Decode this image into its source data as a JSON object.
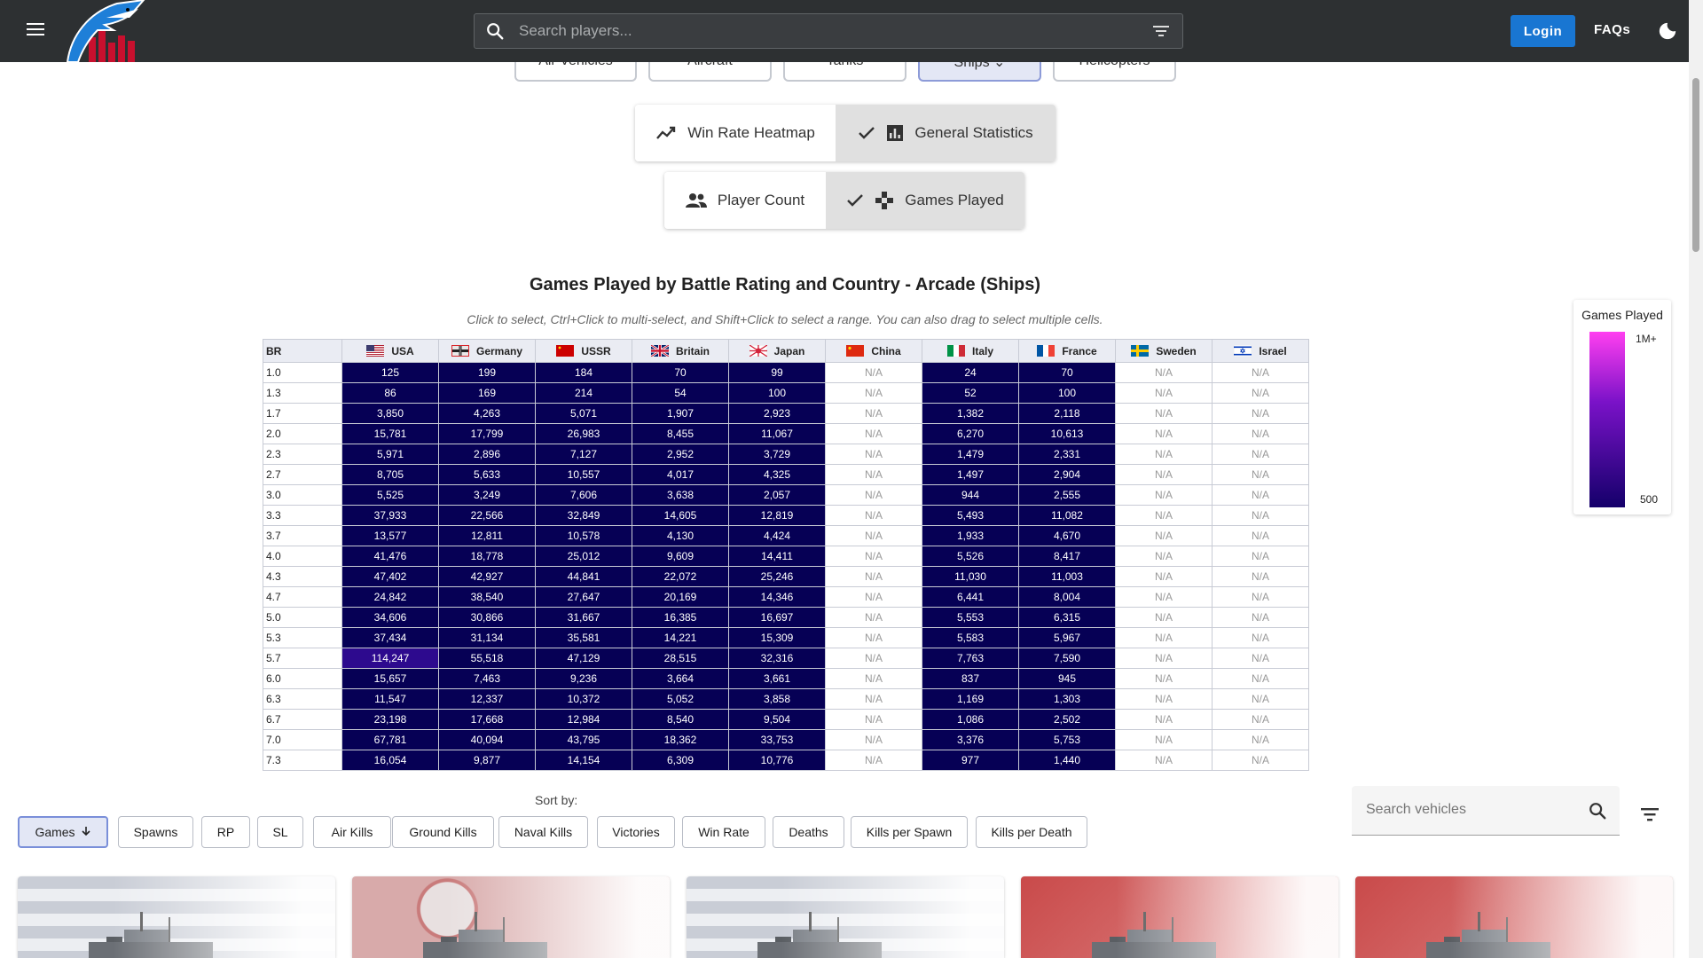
{
  "header": {
    "search_placeholder": "Search players...",
    "login_label": "Login",
    "faqs_label": "FAQs"
  },
  "vehicle_tabs": [
    {
      "label": "Air Vehicles",
      "active": false
    },
    {
      "label": "Aircraft",
      "active": false
    },
    {
      "label": "Tanks",
      "active": false
    },
    {
      "label": "Ships",
      "active": true
    },
    {
      "label": "Helicopters",
      "active": false
    }
  ],
  "view_toggle": {
    "heatmap_label": "Win Rate Heatmap",
    "general_label": "General Statistics",
    "selected": "General Statistics"
  },
  "metric_toggle": {
    "player_count_label": "Player Count",
    "games_played_label": "Games Played",
    "selected": "Games Played"
  },
  "heatmap": {
    "title": "Games Played by Battle Rating and Country - Arcade (Ships)",
    "subtitle": "Click to select, Ctrl+Click to multi-select, and Shift+Click to select a range. You can also drag to select multiple cells.",
    "br_header": "BR",
    "countries": [
      {
        "name": "USA",
        "flag": "usa"
      },
      {
        "name": "Germany",
        "flag": "germany"
      },
      {
        "name": "USSR",
        "flag": "ussr"
      },
      {
        "name": "Britain",
        "flag": "britain"
      },
      {
        "name": "Japan",
        "flag": "japan"
      },
      {
        "name": "China",
        "flag": "china"
      },
      {
        "name": "Italy",
        "flag": "italy"
      },
      {
        "name": "France",
        "flag": "france"
      },
      {
        "name": "Sweden",
        "flag": "sweden"
      },
      {
        "name": "Israel",
        "flag": "israel"
      }
    ],
    "rows": [
      {
        "br": "1.0",
        "values": [
          "125",
          "199",
          "184",
          "70",
          "99",
          "N/A",
          "24",
          "70",
          "N/A",
          "N/A"
        ]
      },
      {
        "br": "1.3",
        "values": [
          "86",
          "169",
          "214",
          "54",
          "100",
          "N/A",
          "52",
          "100",
          "N/A",
          "N/A"
        ]
      },
      {
        "br": "1.7",
        "values": [
          "3,850",
          "4,263",
          "5,071",
          "1,907",
          "2,923",
          "N/A",
          "1,382",
          "2,118",
          "N/A",
          "N/A"
        ]
      },
      {
        "br": "2.0",
        "values": [
          "15,781",
          "17,799",
          "26,983",
          "8,455",
          "11,067",
          "N/A",
          "6,270",
          "10,613",
          "N/A",
          "N/A"
        ]
      },
      {
        "br": "2.3",
        "values": [
          "5,971",
          "2,896",
          "7,127",
          "2,952",
          "3,729",
          "N/A",
          "1,479",
          "2,331",
          "N/A",
          "N/A"
        ]
      },
      {
        "br": "2.7",
        "values": [
          "8,705",
          "5,633",
          "10,557",
          "4,017",
          "4,325",
          "N/A",
          "1,497",
          "2,904",
          "N/A",
          "N/A"
        ]
      },
      {
        "br": "3.0",
        "values": [
          "5,525",
          "3,249",
          "7,606",
          "3,638",
          "2,057",
          "N/A",
          "944",
          "2,555",
          "N/A",
          "N/A"
        ]
      },
      {
        "br": "3.3",
        "values": [
          "37,933",
          "22,566",
          "32,849",
          "14,605",
          "12,819",
          "N/A",
          "5,493",
          "11,082",
          "N/A",
          "N/A"
        ]
      },
      {
        "br": "3.7",
        "values": [
          "13,577",
          "12,811",
          "10,578",
          "4,130",
          "4,424",
          "N/A",
          "1,933",
          "4,670",
          "N/A",
          "N/A"
        ]
      },
      {
        "br": "4.0",
        "values": [
          "41,476",
          "18,778",
          "25,012",
          "9,609",
          "14,411",
          "N/A",
          "5,526",
          "8,417",
          "N/A",
          "N/A"
        ]
      },
      {
        "br": "4.3",
        "values": [
          "47,402",
          "42,927",
          "44,841",
          "22,072",
          "25,246",
          "N/A",
          "11,030",
          "11,003",
          "N/A",
          "N/A"
        ]
      },
      {
        "br": "4.7",
        "values": [
          "24,842",
          "38,540",
          "27,647",
          "20,169",
          "14,346",
          "N/A",
          "6,441",
          "8,004",
          "N/A",
          "N/A"
        ]
      },
      {
        "br": "5.0",
        "values": [
          "34,606",
          "30,866",
          "31,667",
          "16,385",
          "16,697",
          "N/A",
          "5,553",
          "6,315",
          "N/A",
          "N/A"
        ]
      },
      {
        "br": "5.3",
        "values": [
          "37,434",
          "31,134",
          "35,581",
          "14,221",
          "15,309",
          "N/A",
          "5,583",
          "5,967",
          "N/A",
          "N/A"
        ]
      },
      {
        "br": "5.7",
        "values": [
          "114,247",
          "55,518",
          "47,129",
          "28,515",
          "32,316",
          "N/A",
          "7,763",
          "7,590",
          "N/A",
          "N/A"
        ]
      },
      {
        "br": "6.0",
        "values": [
          "15,657",
          "7,463",
          "9,236",
          "3,664",
          "3,661",
          "N/A",
          "837",
          "945",
          "N/A",
          "N/A"
        ]
      },
      {
        "br": "6.3",
        "values": [
          "11,547",
          "12,337",
          "10,372",
          "5,052",
          "3,858",
          "N/A",
          "1,169",
          "1,303",
          "N/A",
          "N/A"
        ]
      },
      {
        "br": "6.7",
        "values": [
          "23,198",
          "17,668",
          "12,984",
          "8,540",
          "9,504",
          "N/A",
          "1,086",
          "2,502",
          "N/A",
          "N/A"
        ]
      },
      {
        "br": "7.0",
        "values": [
          "67,781",
          "40,094",
          "43,795",
          "18,362",
          "33,753",
          "N/A",
          "3,376",
          "5,753",
          "N/A",
          "N/A"
        ]
      },
      {
        "br": "7.3",
        "values": [
          "16,054",
          "9,877",
          "14,154",
          "6,309",
          "10,776",
          "N/A",
          "977",
          "1,440",
          "N/A",
          "N/A"
        ]
      }
    ]
  },
  "legend": {
    "title": "Games Played",
    "max_label": "1M+",
    "min_label": "500",
    "colors": {
      "top": "#ff3ff0",
      "mid": "#7a12c8",
      "bottom": "#14006a"
    }
  },
  "sort": {
    "label": "Sort by:",
    "options": [
      "Games",
      "Spawns",
      "RP",
      "SL",
      "Air Kills",
      "Ground Kills",
      "Naval Kills",
      "Victories",
      "Win Rate",
      "Deaths",
      "Kills per Spawn",
      "Kills per Death"
    ],
    "active": "Games"
  },
  "vehicle_search": {
    "placeholder": "Search vehicles"
  },
  "cards": [
    {
      "flag": "usa"
    },
    {
      "flag": "germany"
    },
    {
      "flag": "usa"
    },
    {
      "flag": "ussr"
    },
    {
      "flag": "ussr"
    }
  ],
  "colors": {
    "topbar": "#2d3032",
    "accent": "#1976d2",
    "cell": "#060055",
    "cell_hot": "#2d0a8e"
  }
}
